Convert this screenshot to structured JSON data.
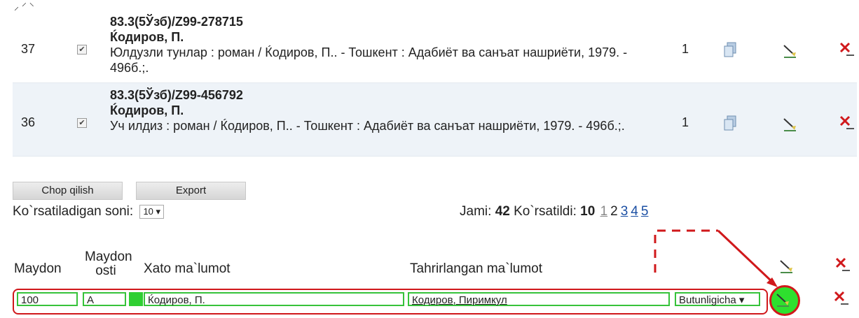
{
  "records": [
    {
      "num": "37",
      "code": "83.3(5Ўзб)/Z99-278715",
      "author": "Ќодиров, П.",
      "text": "Юлдузли тунлар : роман / Ќодиров, П.. - Тошкент : Адабиёт ва санъат нашриёти, 1979. - 496б.;.",
      "qty": "1"
    },
    {
      "num": "36",
      "code": "83.3(5Ўзб)/Z99-456792",
      "author": "Ќодиров, П.",
      "text": "Уч илдиз : роман / Ќодиров, П.. - Тошкент : Адабиёт ва санъат нашриёти, 1979. - 496б.;.",
      "qty": "1"
    }
  ],
  "buttons": {
    "print": "Chop qilish",
    "export": "Export"
  },
  "perpage": {
    "label": "Ko`rsatiladigan soni:",
    "value": "10"
  },
  "totals": {
    "jami_label": "Jami:",
    "jami": "42",
    "shown_label": "Ko`rsatildi:",
    "shown": "10"
  },
  "pages": [
    "1",
    "2",
    "3",
    "4",
    "5"
  ],
  "headers": {
    "maydon": "Maydon",
    "maydon_osti_1": "Maydon",
    "maydon_osti_2": "osti",
    "xato": "Xato ma`lumot",
    "tahrir": "Tahrirlangan ma`lumot"
  },
  "editrow": {
    "maydon": "100",
    "osti": "A",
    "xato": "Ќодиров, П.",
    "tahrir": "Кодиров, Пиримкул",
    "mode": "Butunligicha"
  },
  "colors": {
    "highlight_red": "#d0181b",
    "highlight_green": "#2fcf32",
    "row_alt": "#eef3f8"
  },
  "icons": {
    "copy": "copy-icon",
    "edit": "pencil-icon",
    "delete": "delete-x-icon",
    "save": "pencil-save-icon"
  }
}
